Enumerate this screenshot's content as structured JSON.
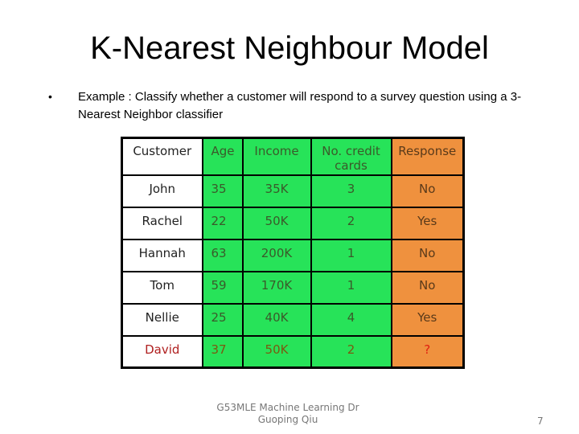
{
  "slide": {
    "title": "K-Nearest Neighbour Model",
    "bullet_symbol": "•",
    "bullet_text": "Example : Classify whether a customer will respond to a survey question using a 3-Nearest Neighbor classifier",
    "footer_line1": "G53MLE  Machine Learning Dr",
    "footer_line2": "Guoping Qiu",
    "page_number": "7"
  },
  "table": {
    "headers": [
      "Customer",
      "Age",
      "Income",
      "No. credit cards",
      "Response"
    ],
    "rows": [
      {
        "customer": "John",
        "age": "35",
        "income": "35K",
        "cards": "3",
        "response": "No"
      },
      {
        "customer": "Rachel",
        "age": "22",
        "income": "50K",
        "cards": "2",
        "response": "Yes"
      },
      {
        "customer": "Hannah",
        "age": "63",
        "income": "200K",
        "cards": "1",
        "response": "No"
      },
      {
        "customer": "Tom",
        "age": "59",
        "income": "170K",
        "cards": "1",
        "response": "No"
      },
      {
        "customer": "Nellie",
        "age": "25",
        "income": "40K",
        "cards": "4",
        "response": "Yes"
      },
      {
        "customer": "David",
        "age": "37",
        "income": "50K",
        "cards": "2",
        "response": "?"
      }
    ]
  },
  "colors": {
    "feature_columns": "#27e359",
    "response_column": "#ef913e",
    "query_row_text": "#b02020"
  }
}
